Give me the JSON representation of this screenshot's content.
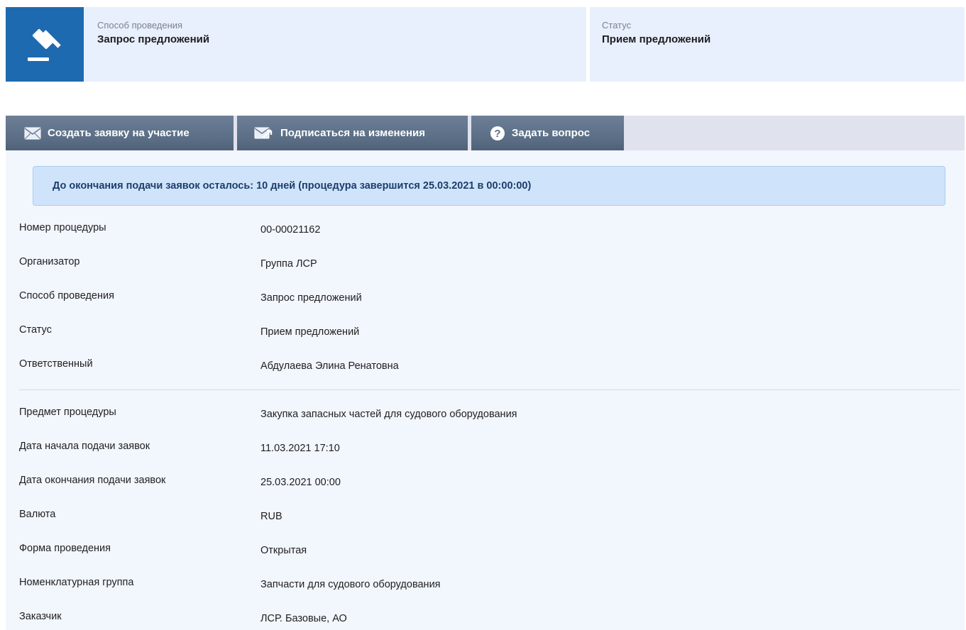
{
  "header": {
    "method_card": {
      "label": "Способ проведения",
      "value": "Запрос предложений",
      "icon": "gavel-icon"
    },
    "status_card": {
      "label": "Статус",
      "value": "Прием предложений"
    }
  },
  "toolbar": {
    "create_application": "Создать заявку на участие",
    "subscribe": "Подписаться на изменения",
    "ask_question": "Задать вопрос"
  },
  "notice": "До окончания подачи заявок осталось: 10 дней (процедура завершится 25.03.2021 в 00:00:00)",
  "details_group1": [
    {
      "label": "Номер процедуры",
      "value": "00-00021162"
    },
    {
      "label": "Организатор",
      "value": "Группа ЛСР"
    },
    {
      "label": "Способ проведения",
      "value": "Запрос предложений"
    },
    {
      "label": "Статус",
      "value": "Прием предложений"
    },
    {
      "label": "Ответственный",
      "value": "Абдулаева Элина Ренатовна"
    }
  ],
  "details_group2": [
    {
      "label": "Предмет процедуры",
      "value": "Закупка запасных частей для судового оборудования"
    },
    {
      "label": "Дата начала подачи заявок",
      "value": "11.03.2021 17:10"
    },
    {
      "label": "Дата окончания подачи заявок",
      "value": "25.03.2021 00:00"
    },
    {
      "label": "Валюта",
      "value": "RUB"
    },
    {
      "label": "Форма проведения",
      "value": "Открытая"
    },
    {
      "label": "Номенклатурная группа",
      "value": "Запчасти для судового оборудования"
    },
    {
      "label": "Заказчик",
      "value": "ЛСР. Базовые, АО"
    }
  ],
  "colors": {
    "accent": "#1e6ab0",
    "toolbar_button": "#5f7188",
    "notice_bg": "#cfe4fb",
    "card_bg": "#e8effd"
  }
}
